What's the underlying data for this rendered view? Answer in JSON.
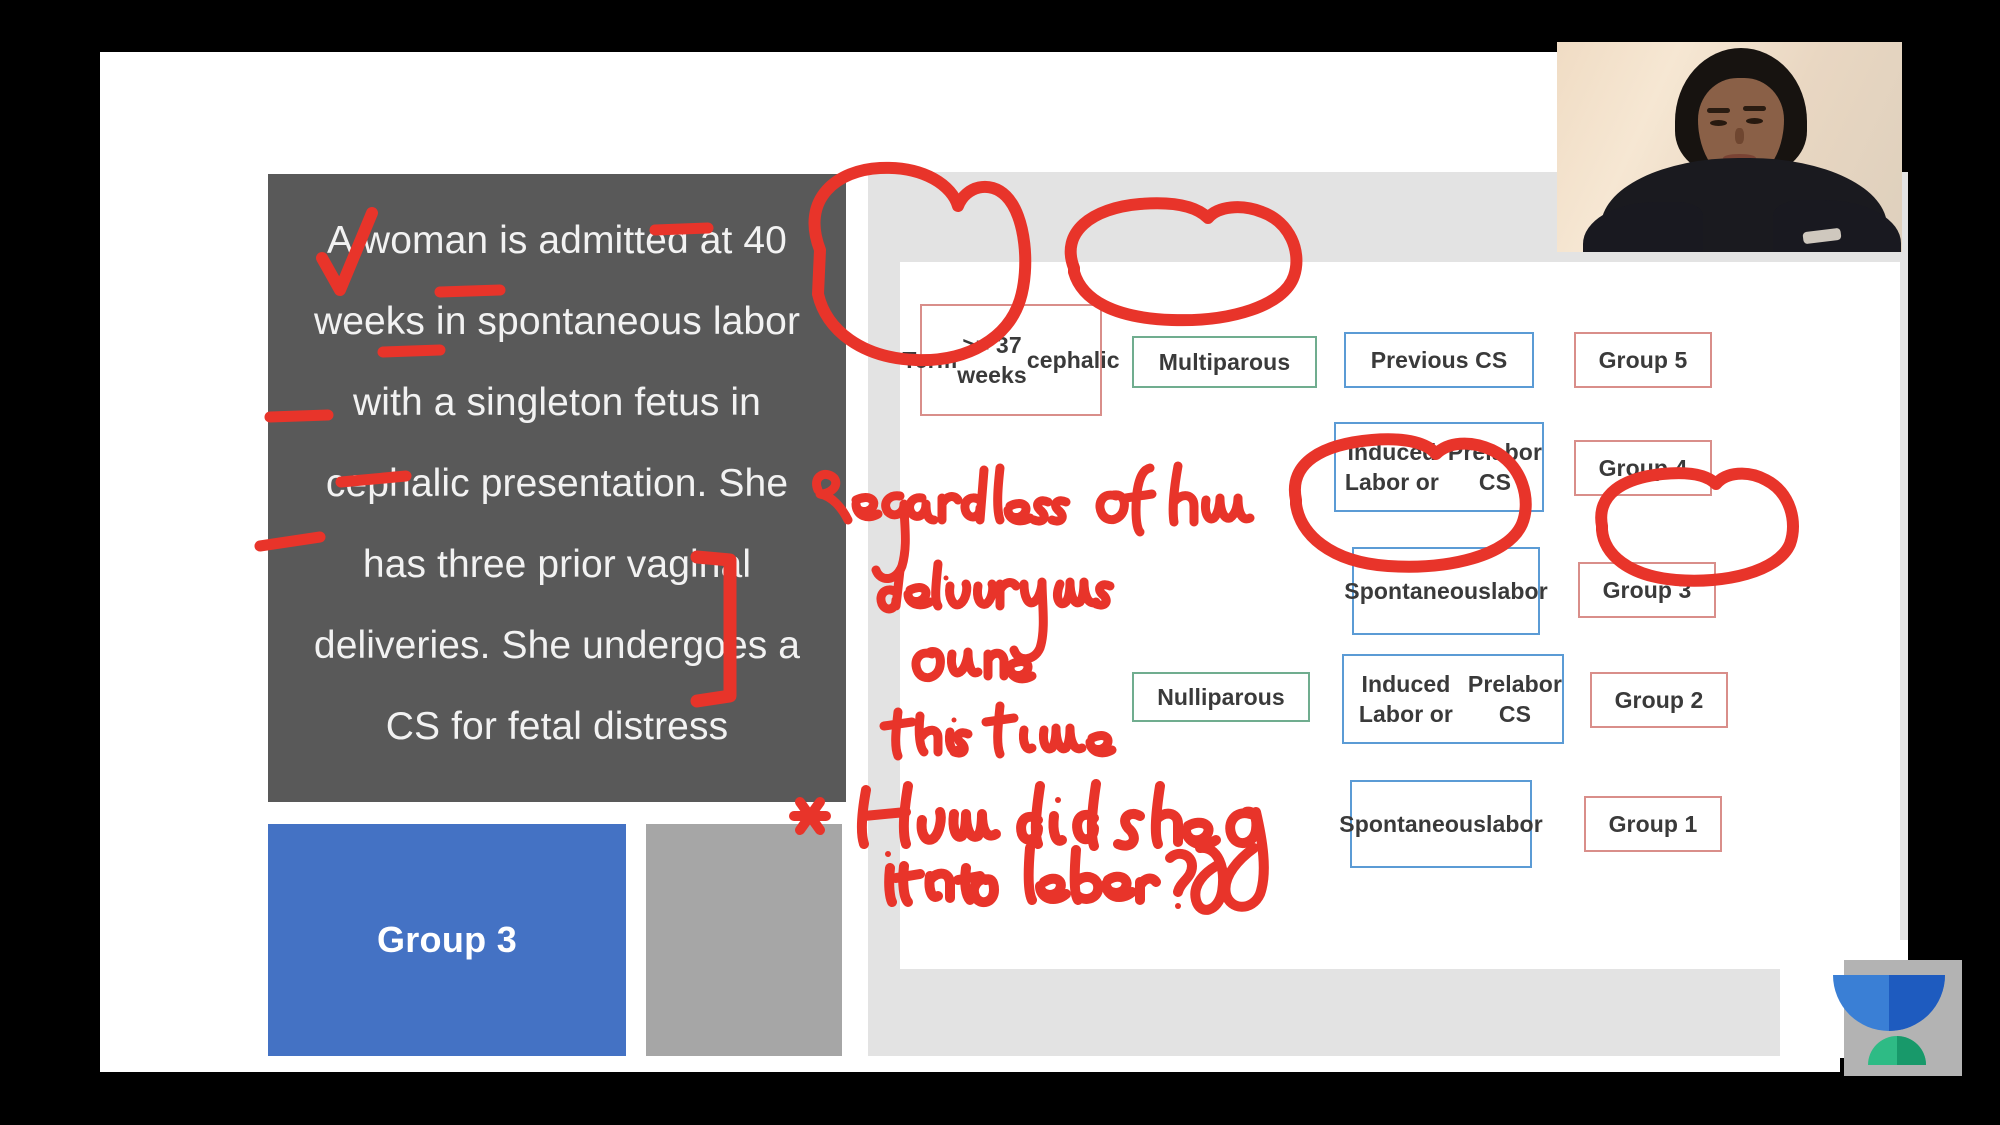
{
  "slide": {
    "vignette": {
      "lines": [
        "A woman is admitted at 40",
        "weeks in spontaneous labor",
        "with a singleton fetus in",
        "cephalic presentation. She",
        "has three prior vaginal",
        "deliveries. She undergoes a",
        "CS for fetal distress"
      ]
    },
    "answer_chip": {
      "label": "Group 3"
    },
    "chart": {
      "nodes": [
        {
          "id": "term",
          "label": "Term\n>= 37 weeks\ncephalic",
          "border": "red"
        },
        {
          "id": "multiparous",
          "label": "Multiparous",
          "border": "green"
        },
        {
          "id": "nulliparous",
          "label": "Nulliparous",
          "border": "green"
        },
        {
          "id": "previous-cs",
          "label": "Previous CS",
          "border": "blue"
        },
        {
          "id": "induced-1",
          "label": "Induced Labor or\nPrelabor CS",
          "border": "blue"
        },
        {
          "id": "spont-1",
          "label": "Spontaneous\nlabor",
          "border": "blue"
        },
        {
          "id": "induced-2",
          "label": "Induced Labor or\nPrelabor CS",
          "border": "blue"
        },
        {
          "id": "spont-2",
          "label": "Spontaneous\nlabor",
          "border": "blue"
        },
        {
          "id": "group5",
          "label": "Group 5",
          "border": "red"
        },
        {
          "id": "group4",
          "label": "Group 4",
          "border": "red"
        },
        {
          "id": "group3",
          "label": "Group 3",
          "border": "red"
        },
        {
          "id": "group2",
          "label": "Group 2",
          "border": "red"
        },
        {
          "id": "group1",
          "label": "Group 1",
          "border": "red"
        }
      ],
      "annotations": {
        "note_regardless": "Regardless of how delivery was done this time",
        "note_question": "* How did she go into labor?",
        "circled": [
          "term",
          "multiparous",
          "spont-1",
          "group3"
        ]
      }
    }
  },
  "colors": {
    "ink_red": "#e8342a",
    "box_red": "#d98e8a",
    "box_blue": "#5b9bd5",
    "box_green": "#70ad8f",
    "chip_blue": "#4472c4",
    "chip_gray": "#a6a6a6",
    "vignette_bg": "#595959",
    "panel_gray": "#e3e3e3"
  }
}
